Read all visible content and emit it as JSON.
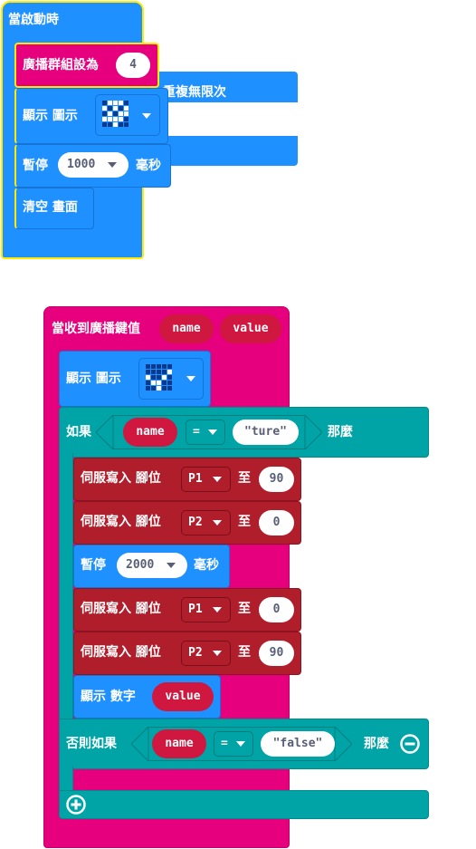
{
  "colors": {
    "basic": "#1e90ff",
    "radio": "#e6007e",
    "logic": "#00a4a6",
    "pins": "#b01e2c",
    "variable": "#d0173f",
    "hat_outline": "#ffeb00"
  },
  "on_start": {
    "label": "當啟動時",
    "set_group_label": "廣播群組設為",
    "group_value": "4",
    "show_icon_label": "顯示 圖示",
    "pause_label": "暫停",
    "pause_value": "1000",
    "ms_label": "毫秒",
    "clear_label": "清空 畫面"
  },
  "forever": {
    "label": "重複無限次"
  },
  "on_received": {
    "label": "當收到廣播鍵值",
    "param_name": "name",
    "param_value": "value",
    "show_icon_label": "顯示 圖示",
    "if_label": "如果",
    "then_label": "那麼",
    "cond_var": "name",
    "operator": "=",
    "compare_value": "\"ture\"",
    "servo_label": "伺服寫入 腳位",
    "to_label": "至",
    "servo_actions": [
      {
        "pin": "P1",
        "value": "90"
      },
      {
        "pin": "P2",
        "value": "0"
      }
    ],
    "pause_label": "暫停",
    "pause_value": "2000",
    "ms_label": "毫秒",
    "servo_actions_2": [
      {
        "pin": "P1",
        "value": "0"
      },
      {
        "pin": "P2",
        "value": "90"
      }
    ],
    "show_number_label": "顯示 數字",
    "show_number_var": "value",
    "elseif_label": "否則如果",
    "elseif_var": "name",
    "elseif_operator": "=",
    "elseif_value": "\"false\"",
    "elseif_then_label": "那麼",
    "remove_icon": "minus-circle-icon",
    "add_icon": "plus-circle-icon"
  },
  "icons": {
    "icon_1": [
      0,
      1,
      1,
      1,
      0,
      1,
      0,
      1,
      0,
      1,
      0,
      1,
      0,
      1,
      1,
      1,
      1,
      1,
      1,
      0,
      0,
      0,
      1,
      0,
      0
    ],
    "icon_2": [
      0,
      0,
      0,
      0,
      0,
      0,
      0,
      0,
      0,
      1,
      1,
      0,
      0,
      1,
      0,
      0,
      1,
      1,
      0,
      0,
      0,
      0,
      1,
      0,
      0
    ]
  }
}
